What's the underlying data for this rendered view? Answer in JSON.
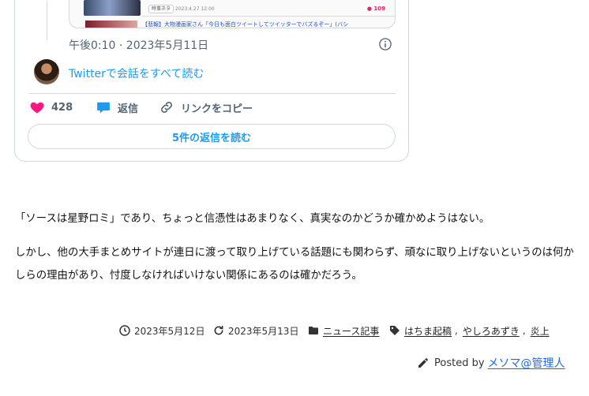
{
  "tweet": {
    "quoted": {
      "tag": "時事ネタ",
      "date": "2023.4.27 12:00",
      "count": "● 109",
      "headline": "【悲報】大物漫画家さん「今日も面白ツイートしてツイッターでバズるぞー」(バシ"
    },
    "time": "午後0:10 · 2023年5月11日",
    "read_conversation": "Twitterで会話をすべて読む",
    "like_count": "428",
    "reply_label": "返信",
    "copy_link_label": "リンクをコピー",
    "replies_button": "5件の返信を読む",
    "colors": {
      "like": "#f91880",
      "link": "#1d9bf0"
    }
  },
  "article": {
    "paragraph1": "「ソースは星野ロミ」であり、ちょっと信憑性はあまりなく、真実なのかどうか確かめようはない。",
    "paragraph2": "しかし、他の大手まとめサイトが連日に渡って取り上げている話題にも関わらず、頑なに取り上げないというのは何かしらの理由があり、忖度しなければいけない関係にあるのは確かだろう。"
  },
  "meta": {
    "published": "2023年5月12日",
    "modified": "2023年5月13日",
    "category": "ニュース記事",
    "tags": [
      "はちま起稿",
      "やしろあずき",
      "炎上"
    ],
    "tag_separator": ",",
    "posted_by": "Posted by",
    "author": "メソマ@管理人"
  }
}
